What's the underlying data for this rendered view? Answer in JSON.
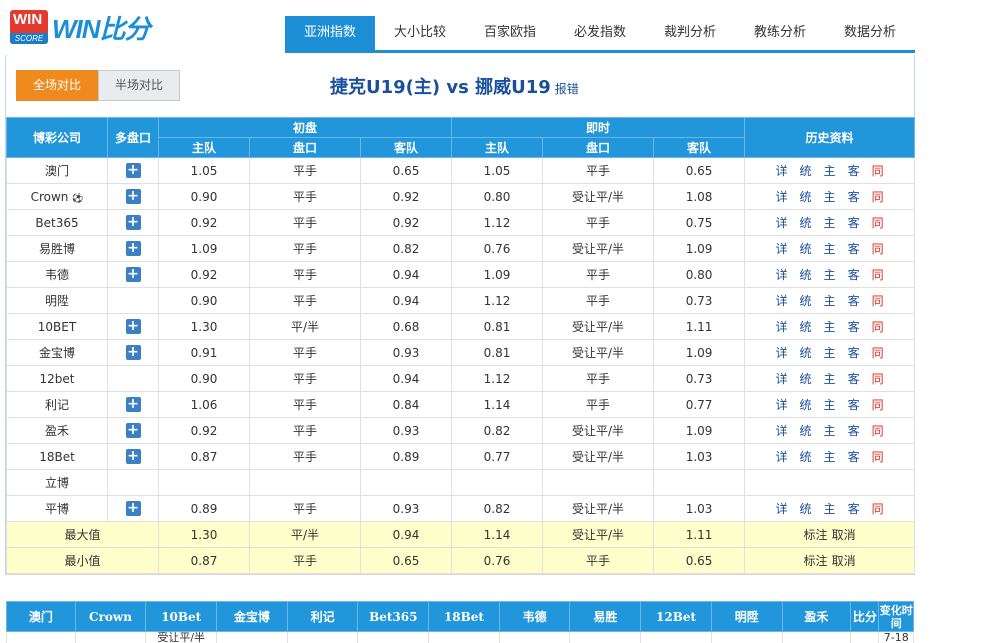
{
  "logo": {
    "badge_top": "WIN",
    "badge_bottom": "SCORE",
    "text": "WIN比分"
  },
  "nav": [
    "亚洲指数",
    "大小比较",
    "百家欧指",
    "必发指数",
    "裁判分析",
    "教练分析",
    "数据分析"
  ],
  "toggle": {
    "full": "全场对比",
    "half": "半场对比"
  },
  "match": {
    "title": "捷克U19(主) vs 挪威U19",
    "report": "报错"
  },
  "table_head": {
    "company": "博彩公司",
    "multi": "多盘口",
    "initial": "初盘",
    "live": "即时",
    "history": "历史资料",
    "home": "主队",
    "line": "盘口",
    "away": "客队"
  },
  "history_links": [
    "详",
    "统",
    "主",
    "客",
    "同"
  ],
  "rows": [
    {
      "name": "澳门",
      "plus": true,
      "i": [
        "1.05",
        "平手",
        "0.65"
      ],
      "l": [
        "1.05",
        "平手",
        "0.65"
      ],
      "hist": true
    },
    {
      "name": "Crown",
      "ball": true,
      "plus": true,
      "i": [
        "0.90",
        "平手",
        "0.92"
      ],
      "l": [
        "0.80",
        "受让平/半",
        "1.08"
      ],
      "hist": true
    },
    {
      "name": "Bet365",
      "plus": true,
      "i": [
        "0.92",
        "平手",
        "0.92"
      ],
      "l": [
        "1.12",
        "平手",
        "0.75"
      ],
      "hist": true
    },
    {
      "name": "易胜博",
      "plus": true,
      "i": [
        "1.09",
        "平手",
        "0.82"
      ],
      "l": [
        "0.76",
        "受让平/半",
        "1.09"
      ],
      "hist": true
    },
    {
      "name": "韦德",
      "plus": true,
      "i": [
        "0.92",
        "平手",
        "0.94"
      ],
      "l": [
        "1.09",
        "平手",
        "0.80"
      ],
      "hist": true
    },
    {
      "name": "明陞",
      "plus": false,
      "i": [
        "0.90",
        "平手",
        "0.94"
      ],
      "l": [
        "1.12",
        "平手",
        "0.73"
      ],
      "hist": true
    },
    {
      "name": "10BET",
      "plus": true,
      "i": [
        "1.30",
        "平/半",
        "0.68"
      ],
      "l": [
        "0.81",
        "受让平/半",
        "1.11"
      ],
      "hist": true
    },
    {
      "name": "金宝博",
      "plus": true,
      "i": [
        "0.91",
        "平手",
        "0.93"
      ],
      "l": [
        "0.81",
        "受让平/半",
        "1.09"
      ],
      "hist": true
    },
    {
      "name": "12bet",
      "plus": false,
      "i": [
        "0.90",
        "平手",
        "0.94"
      ],
      "l": [
        "1.12",
        "平手",
        "0.73"
      ],
      "hist": true
    },
    {
      "name": "利记",
      "plus": true,
      "i": [
        "1.06",
        "平手",
        "0.84"
      ],
      "l": [
        "1.14",
        "平手",
        "0.77"
      ],
      "hist": true
    },
    {
      "name": "盈禾",
      "plus": true,
      "i": [
        "0.92",
        "平手",
        "0.93"
      ],
      "l": [
        "0.82",
        "受让平/半",
        "1.09"
      ],
      "hist": true
    },
    {
      "name": "18Bet",
      "plus": true,
      "i": [
        "0.87",
        "平手",
        "0.89"
      ],
      "l": [
        "0.77",
        "受让平/半",
        "1.03"
      ],
      "hist": true
    },
    {
      "name": "立博",
      "plus": false,
      "i": [
        "",
        "",
        ""
      ],
      "l": [
        "",
        "",
        ""
      ],
      "hist": false
    },
    {
      "name": "平博",
      "plus": true,
      "i": [
        "0.89",
        "平手",
        "0.93"
      ],
      "l": [
        "0.82",
        "受让平/半",
        "1.03"
      ],
      "hist": true
    }
  ],
  "summary": [
    {
      "label": "最大值",
      "i": [
        "1.30",
        "平/半",
        "0.94"
      ],
      "l": [
        "1.14",
        "受让平/半",
        "1.11"
      ],
      "actions": [
        "标注",
        "取消"
      ]
    },
    {
      "label": "最小值",
      "i": [
        "0.87",
        "平手",
        "0.65"
      ],
      "l": [
        "0.76",
        "平手",
        "0.65"
      ],
      "actions": [
        "标注",
        "取消"
      ]
    }
  ],
  "bottom": {
    "headers": [
      "澳门",
      "Crown",
      "10Bet",
      "金宝博",
      "利记",
      "Bet365",
      "18Bet",
      "韦德",
      "易胜",
      "12Bet",
      "明陞",
      "盈禾",
      "比分",
      "变化时间"
    ],
    "first_row": [
      "",
      "",
      "受让平/半",
      "",
      "",
      "",
      "",
      "",
      "",
      "",
      "",
      "",
      "",
      "7-18"
    ]
  },
  "colors": {
    "accent": "#2196db",
    "orange": "#ef8b1e",
    "title": "#1a4f9c",
    "red": "#d9281c",
    "summary_bg": "#ffffcc"
  }
}
